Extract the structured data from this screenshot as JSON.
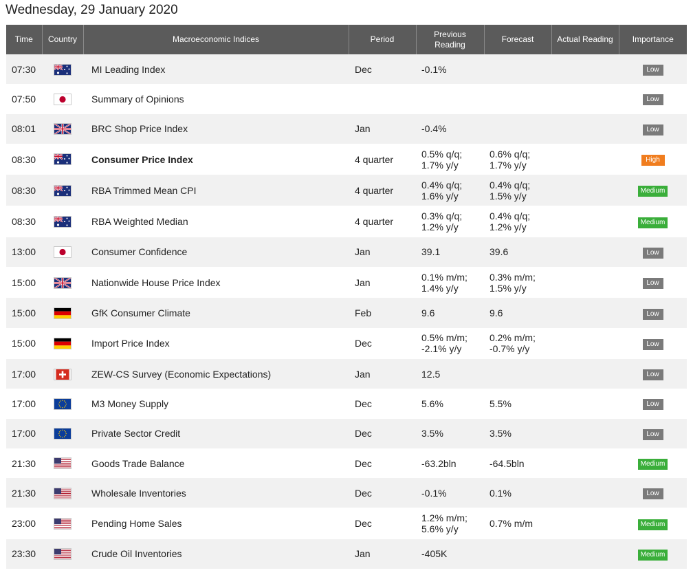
{
  "page": {
    "title": "Wednesday, 29 January 2020"
  },
  "columns": {
    "time": "Time",
    "country": "Country",
    "indices": "Macroeconomic Indices",
    "period": "Period",
    "previous_line1": "Previous",
    "previous_line2": "Reading",
    "forecast": "Forecast",
    "actual": "Actual Reading",
    "importance": "Importance"
  },
  "colors": {
    "header_bg": "#5b5b5b",
    "row_alt": "#f1f1f1",
    "low": "#7a7a7a",
    "medium": "#3aae3a",
    "high": "#f07d1e"
  },
  "rows": [
    {
      "time": "07:30",
      "flag": "australia-flag-icon",
      "indicator": "MI Leading Index",
      "period": "Dec",
      "previous": [
        "-0.1%"
      ],
      "forecast": [],
      "actual": "",
      "importance": "Low"
    },
    {
      "time": "07:50",
      "flag": "japan-flag-icon",
      "indicator": "Summary of Opinions",
      "period": "",
      "previous": [],
      "forecast": [],
      "actual": "",
      "importance": "Low"
    },
    {
      "time": "08:01",
      "flag": "uk-flag-icon",
      "indicator": "BRC Shop Price Index",
      "period": "Jan",
      "previous": [
        "-0.4%"
      ],
      "forecast": [],
      "actual": "",
      "importance": "Low"
    },
    {
      "time": "08:30",
      "flag": "australia-flag-icon",
      "indicator": "Consumer Price Index",
      "bold": true,
      "period": "4 quarter",
      "previous": [
        "0.5% q/q;",
        "1.7% y/y"
      ],
      "forecast": [
        "0.6% q/q;",
        "1.7% y/y"
      ],
      "actual": "",
      "importance": "High"
    },
    {
      "time": "08:30",
      "flag": "australia-flag-icon",
      "indicator": "RBA Trimmed Mean CPI",
      "period": "4 quarter",
      "previous": [
        "0.4% q/q;",
        "1.6% y/y"
      ],
      "forecast": [
        "0.4% q/q;",
        "1.5% y/y"
      ],
      "actual": "",
      "importance": "Medium"
    },
    {
      "time": "08:30",
      "flag": "australia-flag-icon",
      "indicator": "RBA Weighted Median",
      "period": "4 quarter",
      "previous": [
        "0.3% q/q;",
        "1.2% y/y"
      ],
      "forecast": [
        "0.4% q/q;",
        "1.2% y/y"
      ],
      "actual": "",
      "importance": "Medium"
    },
    {
      "time": "13:00",
      "flag": "japan-flag-icon",
      "indicator": "Consumer Confidence",
      "period": "Jan",
      "previous": [
        "39.1"
      ],
      "forecast": [
        "39.6"
      ],
      "actual": "",
      "importance": "Low"
    },
    {
      "time": "15:00",
      "flag": "uk-flag-icon",
      "indicator": "Nationwide House Price Index",
      "period": "Jan",
      "previous": [
        "0.1% m/m;",
        "1.4% y/y"
      ],
      "forecast": [
        "0.3% m/m;",
        "1.5% y/y"
      ],
      "actual": "",
      "importance": "Low"
    },
    {
      "time": "15:00",
      "flag": "germany-flag-icon",
      "indicator": "GfK Consumer Climate",
      "period": "Feb",
      "previous": [
        "9.6"
      ],
      "forecast": [
        "9.6"
      ],
      "actual": "",
      "importance": "Low"
    },
    {
      "time": "15:00",
      "flag": "germany-flag-icon",
      "indicator": "Import Price Index",
      "period": "Dec",
      "previous": [
        "0.5% m/m;",
        "-2.1% y/y"
      ],
      "forecast": [
        "0.2% m/m;",
        "-0.7% y/y"
      ],
      "actual": "",
      "importance": "Low"
    },
    {
      "time": "17:00",
      "flag": "switzerland-flag-icon",
      "indicator": "ZEW-CS Survey (Economic Expectations)",
      "period": "Jan",
      "previous": [
        "12.5"
      ],
      "forecast": [],
      "actual": "",
      "importance": "Low"
    },
    {
      "time": "17:00",
      "flag": "eu-flag-icon",
      "indicator": "M3 Money Supply",
      "period": "Dec",
      "previous": [
        "5.6%"
      ],
      "forecast": [
        "5.5%"
      ],
      "actual": "",
      "importance": "Low"
    },
    {
      "time": "17:00",
      "flag": "eu-flag-icon",
      "indicator": "Private Sector Credit",
      "period": "Dec",
      "previous": [
        "3.5%"
      ],
      "forecast": [
        "3.5%"
      ],
      "actual": "",
      "importance": "Low"
    },
    {
      "time": "21:30",
      "flag": "usa-flag-icon",
      "indicator": "Goods Trade Balance",
      "period": "Dec",
      "previous": [
        "-63.2bln"
      ],
      "forecast": [
        "-64.5bln"
      ],
      "actual": "",
      "importance": "Medium"
    },
    {
      "time": "21:30",
      "flag": "usa-flag-icon",
      "indicator": "Wholesale Inventories",
      "period": "Dec",
      "previous": [
        "-0.1%"
      ],
      "forecast": [
        "0.1%"
      ],
      "actual": "",
      "importance": "Low"
    },
    {
      "time": "23:00",
      "flag": "usa-flag-icon",
      "indicator": "Pending Home Sales",
      "period": "Dec",
      "previous": [
        "1.2% m/m;",
        "5.6% y/y"
      ],
      "forecast": [
        "0.7% m/m"
      ],
      "actual": "",
      "importance": "Medium"
    },
    {
      "time": "23:30",
      "flag": "usa-flag-icon",
      "indicator": "Crude Oil Inventories",
      "period": "Jan",
      "previous": [
        "-405K"
      ],
      "forecast": [],
      "actual": "",
      "importance": "Medium"
    }
  ]
}
